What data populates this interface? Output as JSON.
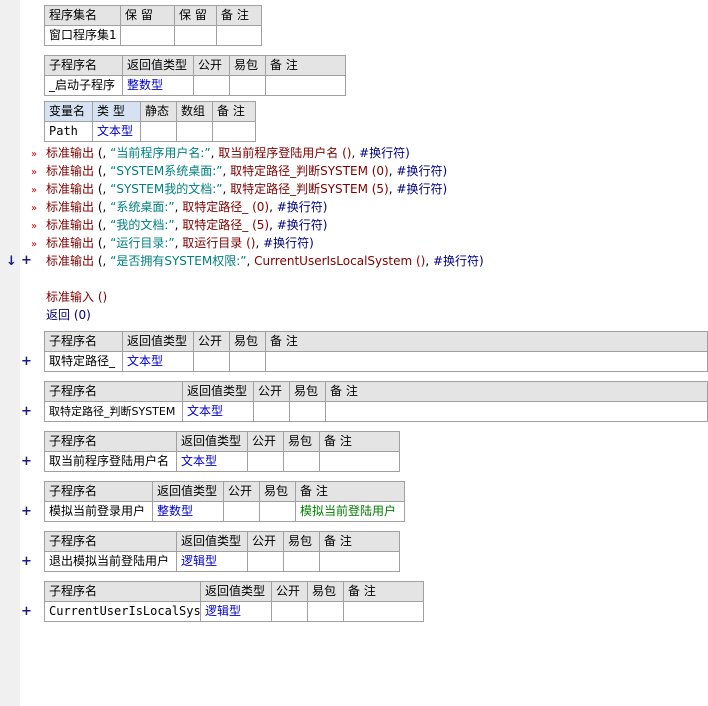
{
  "assembly": {
    "headers": [
      "程序集名",
      "保 留",
      "保 留",
      "备 注"
    ],
    "name": "窗口程序集1"
  },
  "main_sub": {
    "headers": [
      "子程序名",
      "返回值类型",
      "公开",
      "易包",
      "备 注"
    ],
    "name": "_启动子程序",
    "return_type": "整数型"
  },
  "var_table": {
    "headers": [
      "变量名",
      "类 型",
      "静态",
      "数组",
      "备 注"
    ],
    "name": "Path",
    "type": "文本型"
  },
  "code": {
    "lines": [
      {
        "fn": "标准输出",
        "str": "“当前程序用户名:”",
        "call": "取当前程序登陆用户名 ()",
        "tail": "#换行符)"
      },
      {
        "fn": "标准输出",
        "str": "“SYSTEM系统桌面:”",
        "call": "取特定路径_判断SYSTEM (0)",
        "tail": "#换行符)"
      },
      {
        "fn": "标准输出",
        "str": "“SYSTEM我的文档:”",
        "call": "取特定路径_判断SYSTEM (5)",
        "tail": "#换行符)"
      },
      {
        "fn": "标准输出",
        "str": "“系统桌面:”",
        "call": "取特定路径_ (0)",
        "tail": "#换行符)"
      },
      {
        "fn": "标准输出",
        "str": "“我的文档:”",
        "call": "取特定路径_ (5)",
        "tail": "#换行符)"
      },
      {
        "fn": "标准输出",
        "str": "“运行目录:”",
        "call": "取运行目录 ()",
        "tail": "#换行符)"
      },
      {
        "fn": "标准输出",
        "str": "“是否拥有SYSTEM权限:”",
        "call": "CurrentUserIsLocalSystem ()",
        "tail": "#换行符)"
      }
    ],
    "input_line": "标准输入 ()",
    "return_line": "返回 (0)"
  },
  "subs": [
    {
      "headers": [
        "子程序名",
        "返回值类型",
        "公开",
        "易包",
        "备 注"
      ],
      "name": "取特定路径_",
      "return_type": "文本型",
      "note": ""
    },
    {
      "headers": [
        "子程序名",
        "返回值类型",
        "公开",
        "易包",
        "备 注"
      ],
      "name": "取特定路径_判断SYSTEM",
      "return_type": "文本型",
      "note": ""
    },
    {
      "headers": [
        "子程序名",
        "返回值类型",
        "公开",
        "易包",
        "备 注"
      ],
      "name": "取当前程序登陆用户名",
      "return_type": "文本型",
      "note": ""
    },
    {
      "headers": [
        "子程序名",
        "返回值类型",
        "公开",
        "易包",
        "备 注"
      ],
      "name": "模拟当前登录用户",
      "return_type": "整数型",
      "note": "模拟当前登陆用户"
    },
    {
      "headers": [
        "子程序名",
        "返回值类型",
        "公开",
        "易包",
        "备 注"
      ],
      "name": "退出模拟当前登陆用户",
      "return_type": "逻辑型",
      "note": ""
    },
    {
      "headers": [
        "子程序名",
        "返回值类型",
        "公开",
        "易包",
        "备 注"
      ],
      "name": "CurrentUserIsLocalSystem",
      "return_type": "逻辑型",
      "note": ""
    }
  ],
  "icons": {
    "expand": "+",
    "run_marker": "»",
    "current_line": "↓"
  }
}
